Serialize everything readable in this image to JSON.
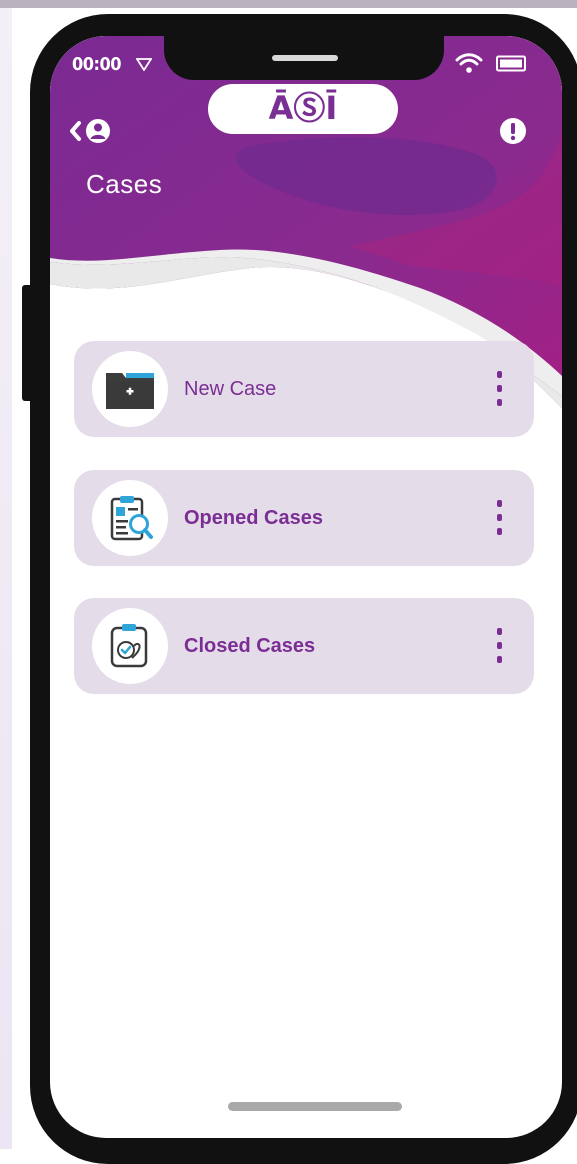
{
  "status_bar": {
    "time": "00:00",
    "icons": [
      "signal-icon",
      "wifi-icon",
      "battery-icon"
    ]
  },
  "header": {
    "logo_text": "ĀⓈĪ",
    "title": "Cases",
    "back_icon": "chevron-left-icon",
    "profile_icon": "user-icon",
    "alert_icon": "exclamation-icon"
  },
  "cards": [
    {
      "label": "New Case",
      "icon": "folder-plus-icon"
    },
    {
      "label": "Opened Cases",
      "icon": "clipboard-search-icon"
    },
    {
      "label": "Closed Cases",
      "icon": "clipboard-check-icon"
    }
  ],
  "colors": {
    "header_purple": "#7b2a94",
    "accent_magenta": "#a8237f",
    "card_bg": "#e5dcea",
    "label_purple": "#7a2e93"
  }
}
